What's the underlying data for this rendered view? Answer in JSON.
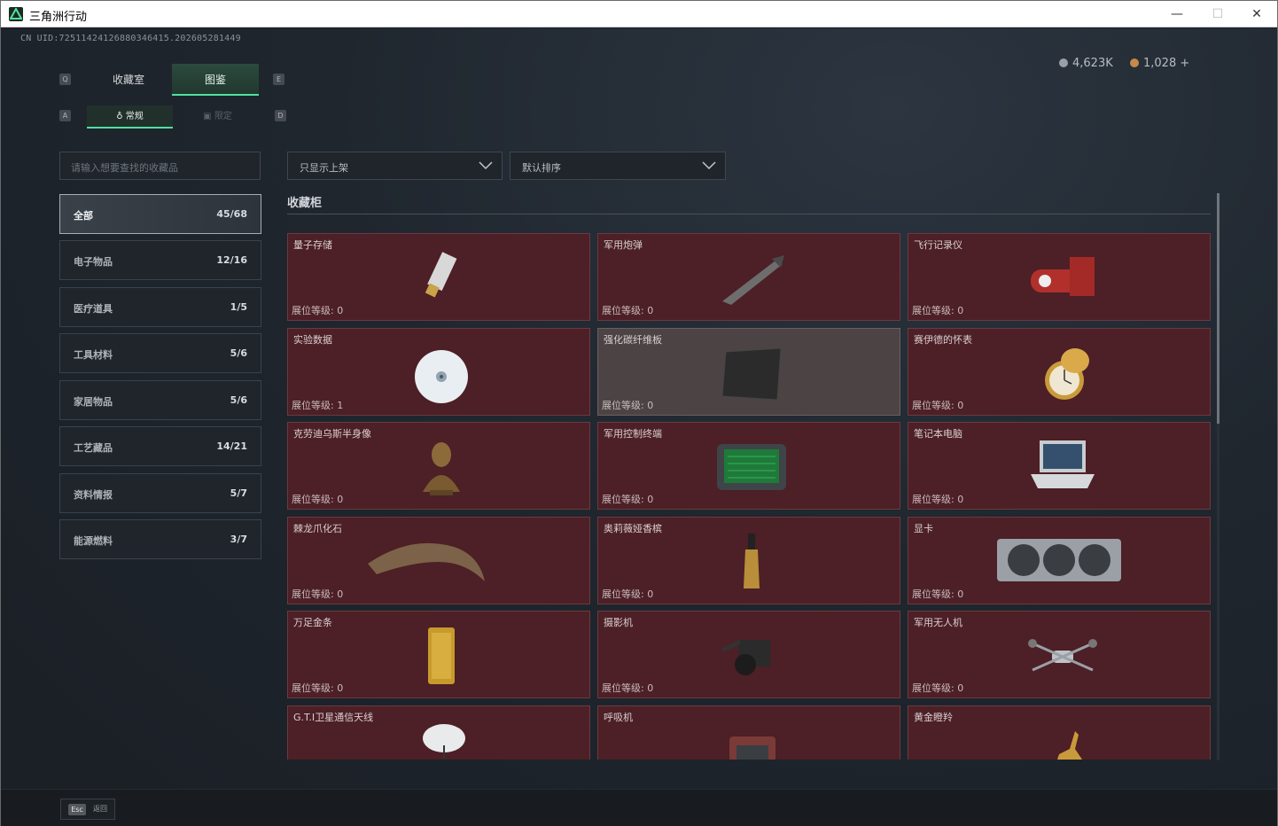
{
  "window": {
    "title": "三角洲行动",
    "controls": [
      "—",
      "☐",
      "✕"
    ]
  },
  "header": {
    "uid": "CN UID:72511424126880346415.202605281449",
    "currency": [
      {
        "value": "4,623K",
        "color": "#9aa0a6"
      },
      {
        "value": "1,028 +",
        "color": "#c58a4a"
      }
    ]
  },
  "keycaps": {
    "q": "Q",
    "e": "E",
    "a": "A",
    "d": "D"
  },
  "tabs": [
    {
      "label": "收藏室",
      "active": false
    },
    {
      "label": "图鉴",
      "active": true
    }
  ],
  "subtabs": [
    {
      "label": "常规",
      "active": true
    },
    {
      "label": "限定",
      "active": false
    }
  ],
  "search": {
    "placeholder": "请输入想要查找的收藏品"
  },
  "filters": {
    "display": "只显示上架",
    "sort": "默认排序"
  },
  "categories": [
    {
      "label": "全部",
      "count": "45/68",
      "active": true
    },
    {
      "label": "电子物品",
      "count": "12/16"
    },
    {
      "label": "医疗道具",
      "count": "1/5"
    },
    {
      "label": "工具材料",
      "count": "5/6"
    },
    {
      "label": "家居物品",
      "count": "5/6"
    },
    {
      "label": "工艺藏品",
      "count": "14/21"
    },
    {
      "label": "资料情报",
      "count": "5/7"
    },
    {
      "label": "能源燃料",
      "count": "3/7"
    }
  ],
  "cabinet": {
    "title": "收藏柜",
    "level_prefix": "展位等级: ",
    "items": [
      {
        "name": "量子存储",
        "level": "0",
        "icon": "usb-drive-icon"
      },
      {
        "name": "军用炮弹",
        "level": "0",
        "icon": "missile-icon"
      },
      {
        "name": "飞行记录仪",
        "level": "0",
        "icon": "flight-recorder-icon"
      },
      {
        "name": "实验数据",
        "level": "1",
        "icon": "disc-icon"
      },
      {
        "name": "强化碳纤维板",
        "level": "0",
        "icon": "carbon-plate-icon",
        "grey": true
      },
      {
        "name": "赛伊德的怀表",
        "level": "0",
        "icon": "pocket-watch-icon"
      },
      {
        "name": "克劳迪乌斯半身像",
        "level": "0",
        "icon": "bust-icon"
      },
      {
        "name": "军用控制终端",
        "level": "0",
        "icon": "terminal-icon"
      },
      {
        "name": "笔记本电脑",
        "level": "0",
        "icon": "laptop-icon"
      },
      {
        "name": "棘龙爪化石",
        "level": "0",
        "icon": "claw-fossil-icon"
      },
      {
        "name": "奥莉薇娅香槟",
        "level": "0",
        "icon": "champagne-icon"
      },
      {
        "name": "显卡",
        "level": "0",
        "icon": "gpu-icon"
      },
      {
        "name": "万足金条",
        "level": "0",
        "icon": "gold-bar-icon"
      },
      {
        "name": "摄影机",
        "level": "0",
        "icon": "camera-icon"
      },
      {
        "name": "军用无人机",
        "level": "0",
        "icon": "drone-icon"
      },
      {
        "name": "G.T.I卫星通信天线",
        "level": "",
        "icon": "satellite-dish-icon"
      },
      {
        "name": "呼吸机",
        "level": "",
        "icon": "ventilator-icon"
      },
      {
        "name": "黄金瞪羚",
        "level": "",
        "icon": "gazelle-icon"
      }
    ]
  },
  "footer": {
    "esc_key": "Esc",
    "back_label": "返回"
  }
}
